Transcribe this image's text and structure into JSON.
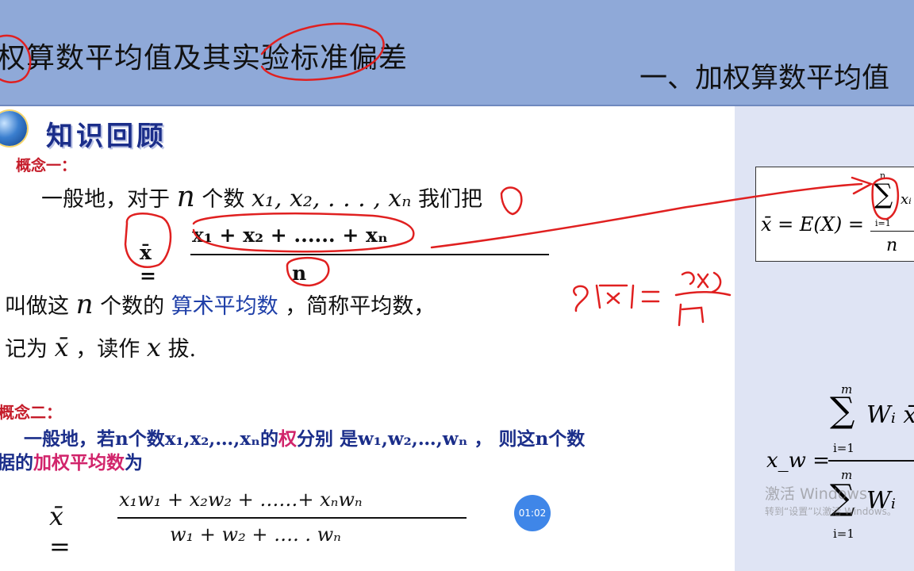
{
  "header": {
    "title": "权算数平均值及其实验标准偏差",
    "subtitle": "一、加权算数平均值"
  },
  "slide": {
    "banner": "知识回顾",
    "concept1_label": "概念一：",
    "concept1_line1_prefix": "一般地，对于",
    "concept1_line1_var": "n",
    "concept1_line1_mid": "个数",
    "concept1_line1_seq": "x₁, x₂, . . . , xₙ",
    "concept1_line1_suffix": "我们把",
    "formula1_lhs": "x̄ =",
    "formula1_numerator": "x₁ + x₂ + ...... + xₙ",
    "formula1_denominator": "n",
    "line2_prefix": "叫做这",
    "line2_var": "n",
    "line2_mid": "个数的",
    "line2_blue": "算术平均数",
    "line2_suffix": "，简称平均数，",
    "line3_prefix": "记为",
    "line3_var": "x̄",
    "line3_mid": "，读作",
    "line3_var2": "x",
    "line3_suffix": "拔.",
    "concept2_label": "概念二：",
    "concept2_line1_a": "一般地，若n个数x₁,x₂,…,xₙ的",
    "concept2_line1_pink": "权",
    "concept2_line1_b": "分别 是w₁,w₂,…,wₙ ，  则这n个数",
    "concept2_line2_a": "据的",
    "concept2_line2_pink": "加权平均数",
    "concept2_line2_b": "为",
    "formula2_lhs": "x̄ =",
    "formula2_numerator": "x₁w₁ + x₂w₂ + ……+ xₙwₙ",
    "formula2_denominator": "w₁ + w₂ + …. . wₙ"
  },
  "sidebar": {
    "box_expr": "x̄ = E(X) =",
    "box_sum_symbol": "∑",
    "box_sum_top": "n",
    "box_sum_bottom": "i=1",
    "box_xi": "xᵢ",
    "box_denominator": "n",
    "xw_lhs": "x_w =",
    "xw_sum_symbol": "∑",
    "xw_top1": "m",
    "xw_bottom1": "i=1",
    "xw_numerator_term": "Wᵢ x̄",
    "xw_top2": "m",
    "xw_bottom2": "i=1",
    "xw_denominator_term": "Wᵢ"
  },
  "overlay": {
    "watermark_line1": "激活 Windows",
    "watermark_line2": "转到“设置”以激活 Windows。",
    "timer": "01:02",
    "handwriting": "s(x̄) = s(x)/√n"
  },
  "colors": {
    "header_bg": "#8fa9d8",
    "side_bg": "#dfe4f4",
    "concept_red": "#c51c2a",
    "def_blue": "#1b2e8a",
    "emphasis_pink": "#d1246b",
    "annotation_red": "#e02020",
    "timer_blue": "#3f86e8"
  }
}
